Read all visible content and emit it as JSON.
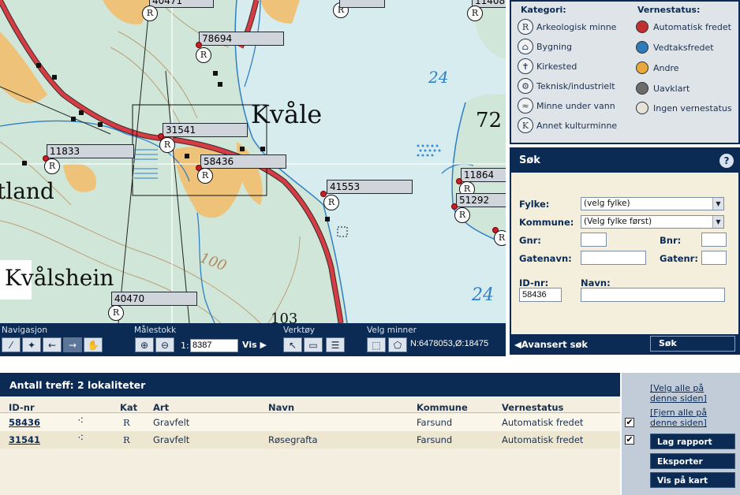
{
  "map": {
    "place_labels": {
      "kvale": "Kvåle",
      "tland": "tland",
      "kvalshein": "Kvålshein",
      "contour_100": "100",
      "depth_24a": "24",
      "depth_24b": "24",
      "island_72": "72",
      "num_103": "103"
    },
    "pins": [
      {
        "id": "30471",
        "label": "40471"
      },
      {
        "id": "11408",
        "label": "11408"
      },
      {
        "id": "78694",
        "label": "78694"
      },
      {
        "id": "31541",
        "label": "31541"
      },
      {
        "id": "11833",
        "label": "11833"
      },
      {
        "id": "58436",
        "label": "58436"
      },
      {
        "id": "41553",
        "label": "41553"
      },
      {
        "id": "11864",
        "label": "11864"
      },
      {
        "id": "51292",
        "label": "51292"
      },
      {
        "id": "40470",
        "label": "40470"
      }
    ],
    "pin_symbol": "R"
  },
  "toolbar": {
    "navigation_title": "Navigasjon",
    "scale_title": "Målestokk",
    "tools_title": "Verktøy",
    "select_title": "Velg minner",
    "scale_prefix": "1:",
    "scale_value": "8387",
    "vis_label": "Vis",
    "coordinates": "N:6478053,Ø:18475"
  },
  "legend": {
    "category_title": "Kategori:",
    "status_title": "Vernestatus:",
    "categories": [
      {
        "label": "Arkeologisk minne",
        "icon": "R"
      },
      {
        "label": "Bygning",
        "icon": "⌂"
      },
      {
        "label": "Kirkested",
        "icon": "✝"
      },
      {
        "label": "Teknisk/industrielt",
        "icon": "⚙"
      },
      {
        "label": "Minne under vann",
        "icon": "≈"
      },
      {
        "label": "Annet kulturminne",
        "icon": "K"
      }
    ],
    "statuses": [
      {
        "label": "Automatisk fredet",
        "color": "#c0302e"
      },
      {
        "label": "Vedtaksfredet",
        "color": "#2f7ab8"
      },
      {
        "label": "Andre",
        "color": "#e8a83a"
      },
      {
        "label": "Uavklart",
        "color": "#6c6c6c"
      },
      {
        "label": "Ingen vernestatus",
        "color": "#e6e3da"
      }
    ]
  },
  "search": {
    "title": "Søk",
    "help": "?",
    "fylke_label": "Fylke:",
    "fylke_value": "(velg fylke)",
    "kommune_label": "Kommune:",
    "kommune_value": "(Velg fylke først)",
    "gnr_label": "Gnr:",
    "bnr_label": "Bnr:",
    "gatenavn_label": "Gatenavn:",
    "gatenr_label": "Gatenr:",
    "idnr_label": "ID-nr:",
    "idnr_value": "58436",
    "navn_label": "Navn:",
    "advanced_label": "Avansert søk",
    "search_button": "Søk"
  },
  "results": {
    "title": "Antall treff: 2 lokaliteter",
    "columns": [
      "ID-nr",
      "Kat",
      "Art",
      "Navn",
      "Kommune",
      "Vernestatus"
    ],
    "rows": [
      {
        "id": "58436",
        "kat": "R",
        "art": "Gravfelt",
        "navn": "",
        "kommune": "Farsund",
        "status": "Automatisk fredet",
        "checked": "✔"
      },
      {
        "id": "31541",
        "kat": "R",
        "art": "Gravfelt",
        "navn": "Røsegrafta",
        "kommune": "Farsund",
        "status": "Automatisk fredet",
        "checked": "✔"
      }
    ],
    "group_symbol": "⁖"
  },
  "actions": {
    "select_all": "[Velg alle på denne siden]",
    "remove_all": "[Fjern alle på denne siden]",
    "report": "Lag rapport",
    "export": "Eksporter",
    "show_on_map": "Vis på kart"
  },
  "colors": {
    "navy": "#0b2b55",
    "map_green": "#cfe6d8",
    "water": "#d6ecef",
    "road": "#d63c44",
    "farm": "#efc27a"
  }
}
